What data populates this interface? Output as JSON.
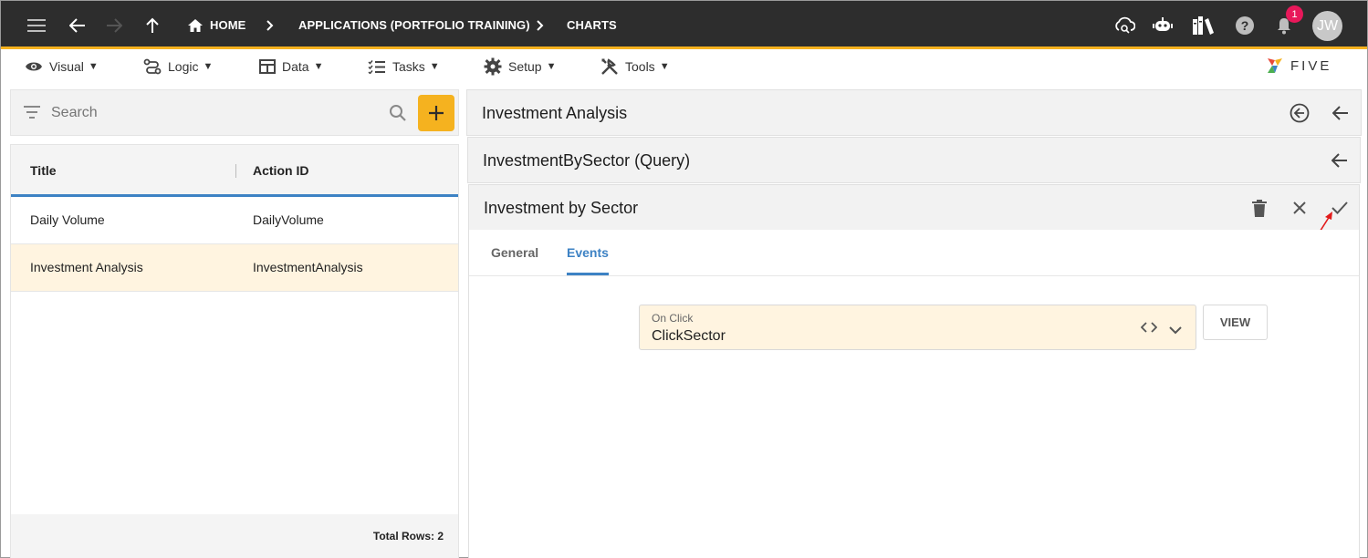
{
  "topbar": {
    "breadcrumbs": [
      "HOME",
      "APPLICATIONS (PORTFOLIO TRAINING)",
      "CHARTS"
    ],
    "notification_count": "1",
    "avatar_initials": "JW"
  },
  "menu": {
    "items": [
      {
        "label": "Visual"
      },
      {
        "label": "Logic"
      },
      {
        "label": "Data"
      },
      {
        "label": "Tasks"
      },
      {
        "label": "Setup"
      },
      {
        "label": "Tools"
      }
    ],
    "caret": "▼"
  },
  "logo": {
    "text": "FIVE"
  },
  "search": {
    "placeholder": "Search"
  },
  "list": {
    "columns": [
      "Title",
      "Action ID"
    ],
    "rows": [
      {
        "title": "Daily Volume",
        "action_id": "DailyVolume"
      },
      {
        "title": "Investment Analysis",
        "action_id": "InvestmentAnalysis"
      }
    ],
    "total_rows": "Total Rows: 2"
  },
  "panels": {
    "investment_analysis": "Investment Analysis",
    "query": "InvestmentBySector (Query)",
    "form_title": "Investment by Sector"
  },
  "tabs": [
    "General",
    "Events"
  ],
  "field": {
    "label": "On Click",
    "value": "ClickSector",
    "view_label": "VIEW"
  },
  "colors": {
    "accent": "#f5b21f",
    "tab_active": "#3d82c4",
    "selected_row": "#fff4e0",
    "badge": "#e8185a"
  }
}
